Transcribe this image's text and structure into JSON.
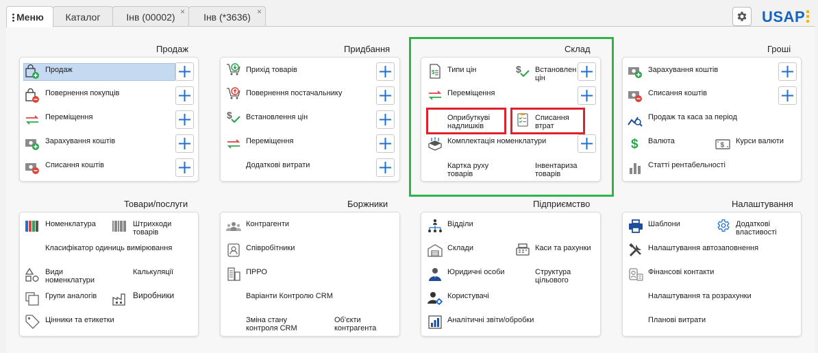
{
  "tabs": [
    {
      "label": "Меню",
      "active": true
    },
    {
      "label": "Каталог"
    },
    {
      "label": "Інв (00002)",
      "closable": true
    },
    {
      "label": "Інв (*3636)",
      "closable": true
    }
  ],
  "close_glyph": "×",
  "brand": {
    "name": "USAP",
    "color": "#1565c0",
    "accent": "#f7b500"
  },
  "colors": {
    "plus": "#1e6fd0",
    "highlight": "#c5d9f1",
    "annotation_red": "#e0202a",
    "annotation_green": "#2db54a"
  },
  "sections": {
    "prodazh": {
      "title": "Продаж",
      "items": {
        "sale": "Продаж",
        "returns": "Повернення покупців",
        "move": "Переміщення",
        "income": "Зарахування коштів",
        "writeoff": "Списання коштів"
      }
    },
    "prydbannia": {
      "title": "Придбання",
      "items": {
        "receipt": "Прихід товарів",
        "supplier_return": "Повернення постачальнику",
        "set_prices": "Встановлення цін",
        "move": "Переміщення",
        "extra_costs": "Додаткові витрати"
      }
    },
    "sklad": {
      "title": "Склад",
      "items": {
        "price_types": "Типи цін",
        "set_prices": "Встановлення цін",
        "move": "Переміщення",
        "surplus": "Оприбуткуві надлишків",
        "losses": "Списання втрат",
        "bundling": "Комплектація номенклатури",
        "stock_card": "Картка руху товарів",
        "inventory": "Інвентариза товарів"
      }
    },
    "hroshi": {
      "title": "Гроші",
      "items": {
        "income": "Зарахування коштів",
        "writeoff": "Списання коштів",
        "sales_cash": "Продаж та каса за період",
        "currency": "Валюта",
        "rates": "Курси валюти",
        "profitability": "Статті рентабельності"
      }
    },
    "tovary": {
      "title": "Товари/послуги",
      "items": {
        "nomenclature": "Номенклатура",
        "barcodes": "Штрихкоди товарів",
        "units": "Класифікатор одиниць вимірювання",
        "types": "Види номенклатури",
        "calculations": "Калькуляції",
        "analog_groups": "Групи аналогів",
        "manufacturers": "Виробники",
        "price_tags": "Цінники та етикетки"
      }
    },
    "borzhnyky": {
      "title": "Боржники",
      "items": {
        "counterparties": "Контрагенти",
        "employees": "Співробітники",
        "prro": "ПРРО",
        "crm_variants": "Варіанти Контролю CRM",
        "crm_state": "Зміна стану контроля CRM",
        "cp_objects": "Об'єкти контрагента"
      }
    },
    "pidpryiemstvo": {
      "title": "Підприємство",
      "items": {
        "departments": "Відділи",
        "warehouses": "Склади",
        "cash_accounts": "Каси та рахунки",
        "legal_entities": "Юридичні особи",
        "structure": "Структура цільового",
        "users": "Користувачі",
        "reports": "Аналітичні звіти/обробки"
      }
    },
    "nalashtuvannia": {
      "title": "Налаштування",
      "items": {
        "templates": "Шаблони",
        "extra_props": "Додаткові властивості",
        "autofill": "Налаштування автозаповнення",
        "fin_contacts": "Фінансові контакти",
        "settings_calc": "Налаштування та розрахунки",
        "planned_costs": "Планові витрати"
      }
    }
  }
}
